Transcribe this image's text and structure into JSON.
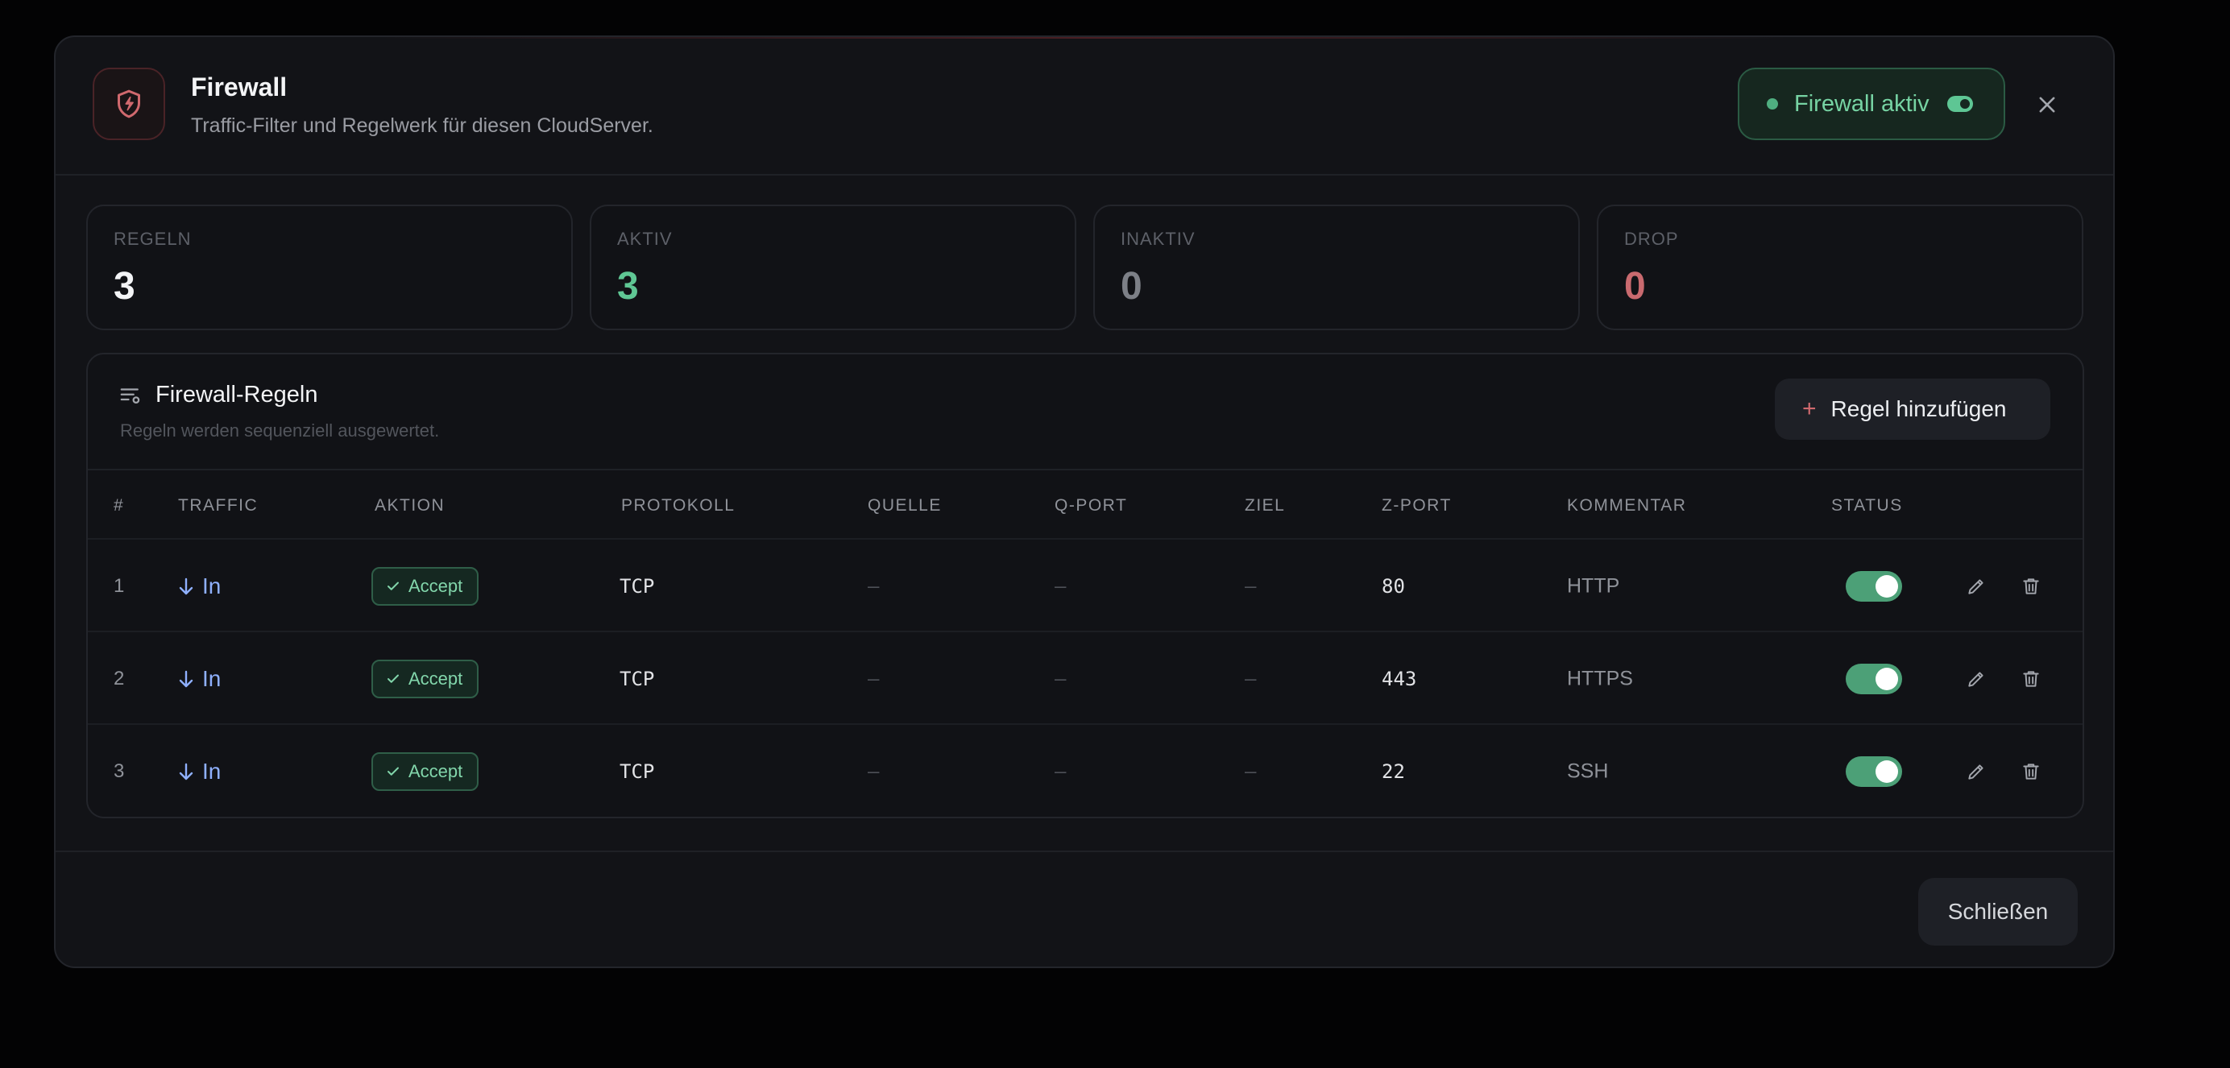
{
  "header": {
    "title": "Firewall",
    "subtitle": "Traffic-Filter und Regelwerk für diesen CloudServer.",
    "status_label": "Firewall aktiv",
    "icon": "shield-bolt-icon"
  },
  "stats": [
    {
      "label": "REGELN",
      "value": "3",
      "color": "#f3f4f6"
    },
    {
      "label": "AKTIV",
      "value": "3",
      "color": "#5fc794"
    },
    {
      "label": "INAKTIV",
      "value": "0",
      "color": "#7d8087"
    },
    {
      "label": "DROP",
      "value": "0",
      "color": "#c96a6f"
    }
  ],
  "rules_panel": {
    "title": "Firewall-Regeln",
    "subtitle": "Regeln werden sequenziell ausgewertet.",
    "add_button": "Regel hinzufügen",
    "columns": [
      "#",
      "TRAFFIC",
      "AKTION",
      "PROTOKOLL",
      "QUELLE",
      "Q-PORT",
      "ZIEL",
      "Z-PORT",
      "KOMMENTAR",
      "STATUS"
    ],
    "rows": [
      {
        "num": "1",
        "traffic": "In",
        "action": "Accept",
        "protocol": "TCP",
        "source": "–",
        "source_port": "–",
        "destination": "–",
        "dest_port": "80",
        "comment": "HTTP",
        "enabled": true
      },
      {
        "num": "2",
        "traffic": "In",
        "action": "Accept",
        "protocol": "TCP",
        "source": "–",
        "source_port": "–",
        "destination": "–",
        "dest_port": "443",
        "comment": "HTTPS",
        "enabled": true
      },
      {
        "num": "3",
        "traffic": "In",
        "action": "Accept",
        "protocol": "TCP",
        "source": "–",
        "source_port": "–",
        "destination": "–",
        "dest_port": "22",
        "comment": "SSH",
        "enabled": true
      }
    ]
  },
  "footer": {
    "close_button": "Schließen"
  },
  "colors": {
    "accent_red": "#d0696e",
    "accent_green": "#5fc794",
    "inbound_blue": "#8fb0ff",
    "background": "#121317"
  }
}
